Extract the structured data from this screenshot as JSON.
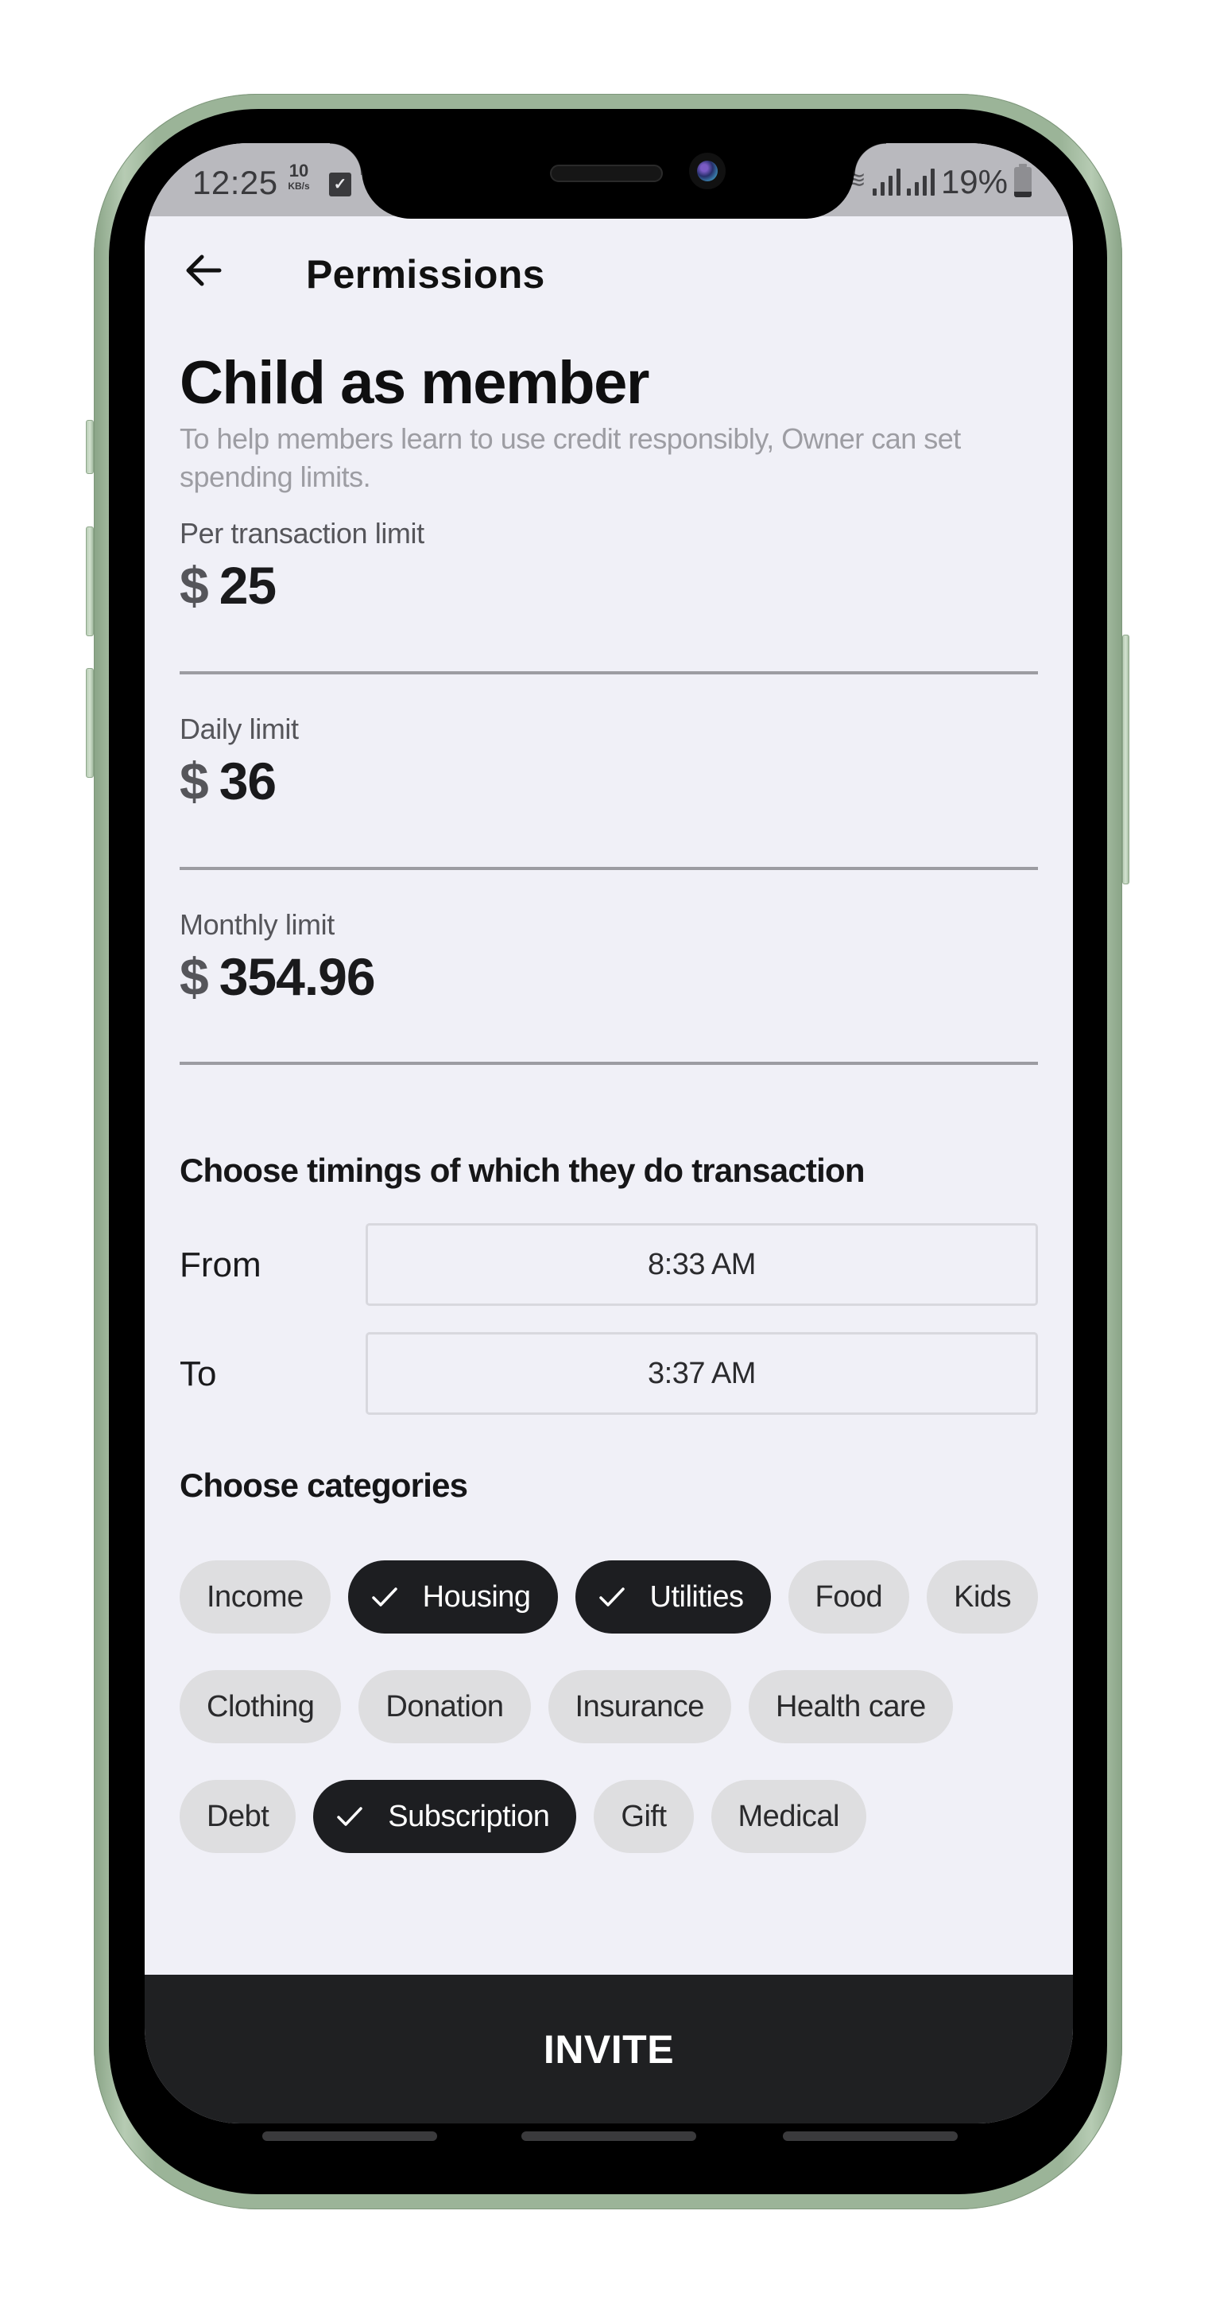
{
  "status_bar": {
    "time": "12:25",
    "net_speed_value": "10",
    "net_speed_unit": "KB/s",
    "notification_icon": "check-square-icon",
    "battery_percent_text": "19%",
    "battery_level": 0.19,
    "icons": [
      "vibrate-icon",
      "signal-icon",
      "signal-icon",
      "battery-icon"
    ]
  },
  "app_bar": {
    "back_icon": "arrow-left-icon",
    "title": "Permissions"
  },
  "header": {
    "title": "Child as member",
    "description": "To help members learn to use credit responsibly, Owner can set spending limits."
  },
  "limits": [
    {
      "label": "Per transaction limit",
      "currency": "$",
      "value": "25"
    },
    {
      "label": "Daily limit",
      "currency": "$",
      "value": "36"
    },
    {
      "label": "Monthly limit",
      "currency": "$",
      "value": "354.96"
    }
  ],
  "timings": {
    "title": "Choose timings of which they do transaction",
    "from_label": "From",
    "from_value": "8:33 AM",
    "to_label": "To",
    "to_value": "3:37 AM"
  },
  "categories": {
    "title": "Choose categories",
    "items": [
      {
        "label": "Income",
        "selected": false
      },
      {
        "label": "Housing",
        "selected": true
      },
      {
        "label": "Utilities",
        "selected": true
      },
      {
        "label": "Food",
        "selected": false
      },
      {
        "label": "Kids",
        "selected": false
      },
      {
        "label": "Clothing",
        "selected": false
      },
      {
        "label": "Donation",
        "selected": false
      },
      {
        "label": "Insurance",
        "selected": false
      },
      {
        "label": "Health care",
        "selected": false
      },
      {
        "label": "Debt",
        "selected": false
      },
      {
        "label": "Subscription",
        "selected": true
      },
      {
        "label": "Gift",
        "selected": false
      },
      {
        "label": "Medical",
        "selected": false
      }
    ]
  },
  "footer": {
    "invite_label": "INVITE"
  },
  "colors": {
    "screen_bg": "#f0f0f7",
    "chip_selected_bg": "#1d1e21",
    "chip_bg": "#dedee0",
    "invite_bg": "#1f2022",
    "phone_frame": "#9bb498"
  }
}
